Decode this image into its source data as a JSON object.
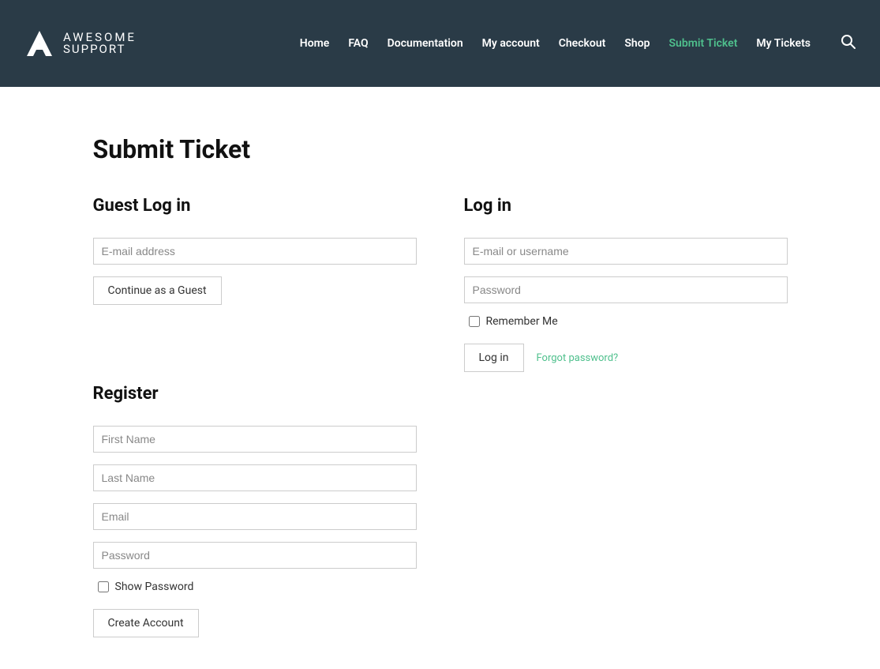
{
  "logo": {
    "top": "AWESOME",
    "bottom": "SUPPORT"
  },
  "nav": {
    "home": "Home",
    "faq": "FAQ",
    "documentation": "Documentation",
    "my_account": "My account",
    "checkout": "Checkout",
    "shop": "Shop",
    "submit_ticket": "Submit Ticket",
    "my_tickets": "My Tickets"
  },
  "page": {
    "title": "Submit Ticket"
  },
  "guest": {
    "title": "Guest Log in",
    "email_placeholder": "E-mail address",
    "continue_button": "Continue as a Guest"
  },
  "login": {
    "title": "Log in",
    "email_placeholder": "E-mail or username",
    "password_placeholder": "Password",
    "remember_label": "Remember Me",
    "login_button": "Log in",
    "forgot_link": "Forgot password?"
  },
  "register": {
    "title": "Register",
    "first_name_placeholder": "First Name",
    "last_name_placeholder": "Last Name",
    "email_placeholder": "Email",
    "password_placeholder": "Password",
    "show_password_label": "Show Password",
    "create_button": "Create Account"
  }
}
